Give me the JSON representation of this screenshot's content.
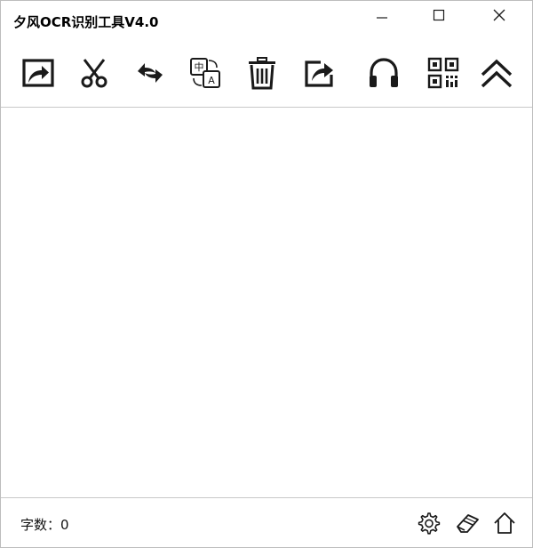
{
  "window": {
    "title": "夕风OCR识别工具V4.0",
    "controls": {
      "minimize_icon": "minimize-icon",
      "maximize_icon": "maximize-icon",
      "close_icon": "close-icon"
    }
  },
  "toolbar": {
    "items": [
      {
        "icon": "screenshot-capture-icon"
      },
      {
        "icon": "scissors-icon"
      },
      {
        "icon": "swap-arrows-icon"
      },
      {
        "icon": "translate-icon",
        "glyph_top": "中",
        "glyph_bottom": "A"
      },
      {
        "icon": "trash-icon"
      },
      {
        "icon": "share-export-icon"
      },
      {
        "icon": "headphones-icon"
      },
      {
        "icon": "qr-code-icon"
      },
      {
        "icon": "double-chevron-up-icon"
      }
    ]
  },
  "editor": {
    "value": ""
  },
  "status": {
    "word_count_label": "字数：0",
    "icons": [
      "gear-icon",
      "eraser-icon",
      "home-icon"
    ]
  },
  "colors": {
    "icon": "#1a1a1a",
    "divider": "#c8c8c8",
    "background": "#ffffff"
  }
}
